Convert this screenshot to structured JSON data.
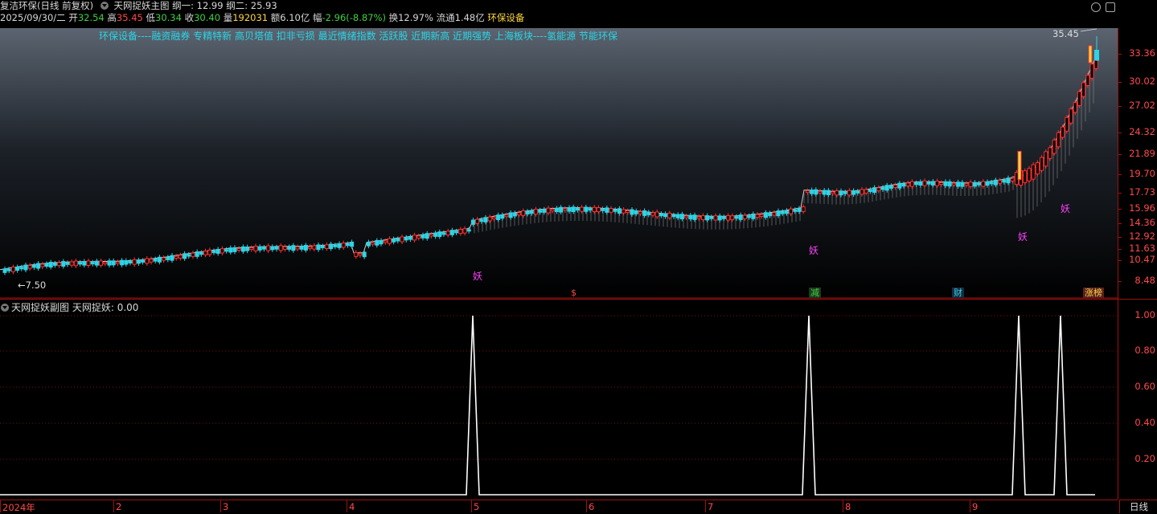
{
  "header": {
    "stock_name": "复洁环保(日线 前复权)",
    "indicator_main": "天网捉妖主图",
    "param1_label": "纲一:",
    "param1_value": "12.99",
    "param2_label": "纲二:",
    "param2_value": "25.93"
  },
  "quote": {
    "date": "2025/09/30/二",
    "open_label": "开",
    "open": "32.54",
    "high_label": "高",
    "high": "35.45",
    "low_label": "低",
    "low": "30.34",
    "close_label": "收",
    "close": "30.40",
    "vol_label": "量",
    "vol": "192031",
    "amount_label": "额",
    "amount": "6.10亿",
    "chg_label": "幅",
    "chg": "-2.96(-8.87%)",
    "turnover_label": "换",
    "turnover": "12.97%",
    "float_label": "流通",
    "float": "1.48亿",
    "sector": "环保设备"
  },
  "concepts": "环保设备----融资融券 专精特新 高贝塔值 扣非亏损 最近情绪指数 活跃股 近期新高 近期强势 上海板块----氢能源 节能环保",
  "main_axis": [
    "33.36",
    "30.02",
    "27.02",
    "24.32",
    "21.89",
    "19.70",
    "17.73",
    "15.96",
    "14.36",
    "12.92",
    "11.63",
    "10.47",
    "8.48"
  ],
  "annotations": {
    "high_mark": "35.45",
    "low_mark": "7.50",
    "yao": "妖",
    "tag_s": "$",
    "tag_jian": "减",
    "tag_cai": "财",
    "tag_zhangbang": "涨榜"
  },
  "sub": {
    "title": "天网捉妖副图",
    "series_label": "天网捉妖:",
    "series_value": "0.00",
    "axis": [
      "1.00",
      "0.80",
      "0.60",
      "0.40",
      "0.20"
    ]
  },
  "xaxis": [
    "2024年",
    "2",
    "3",
    "4",
    "5",
    "6",
    "7",
    "8",
    "9"
  ],
  "period": "日线",
  "chart_data": [
    {
      "type": "candlestick",
      "title": "天网捉妖主图",
      "ylim": [
        7.5,
        35.45
      ],
      "x_labels": [
        "2024年",
        "2",
        "3",
        "4",
        "5",
        "6",
        "7",
        "8",
        "9"
      ],
      "high": 35.45,
      "low": 7.5,
      "signals_yao_months": [
        "5",
        "8",
        "9",
        "9"
      ]
    },
    {
      "type": "line",
      "title": "天网捉妖副图",
      "series": [
        {
          "name": "天网捉妖",
          "values": [
            0,
            1,
            0,
            1,
            0,
            1,
            0,
            1,
            0
          ]
        }
      ],
      "ylim": [
        0,
        1
      ]
    }
  ],
  "colors": {
    "up": "#ff3030",
    "down": "#2bd5e6",
    "text_red": "#ff4a4a",
    "text_cyan": "#2bd5e6",
    "yellow": "#ffd740",
    "magenta": "#ff40ff"
  }
}
